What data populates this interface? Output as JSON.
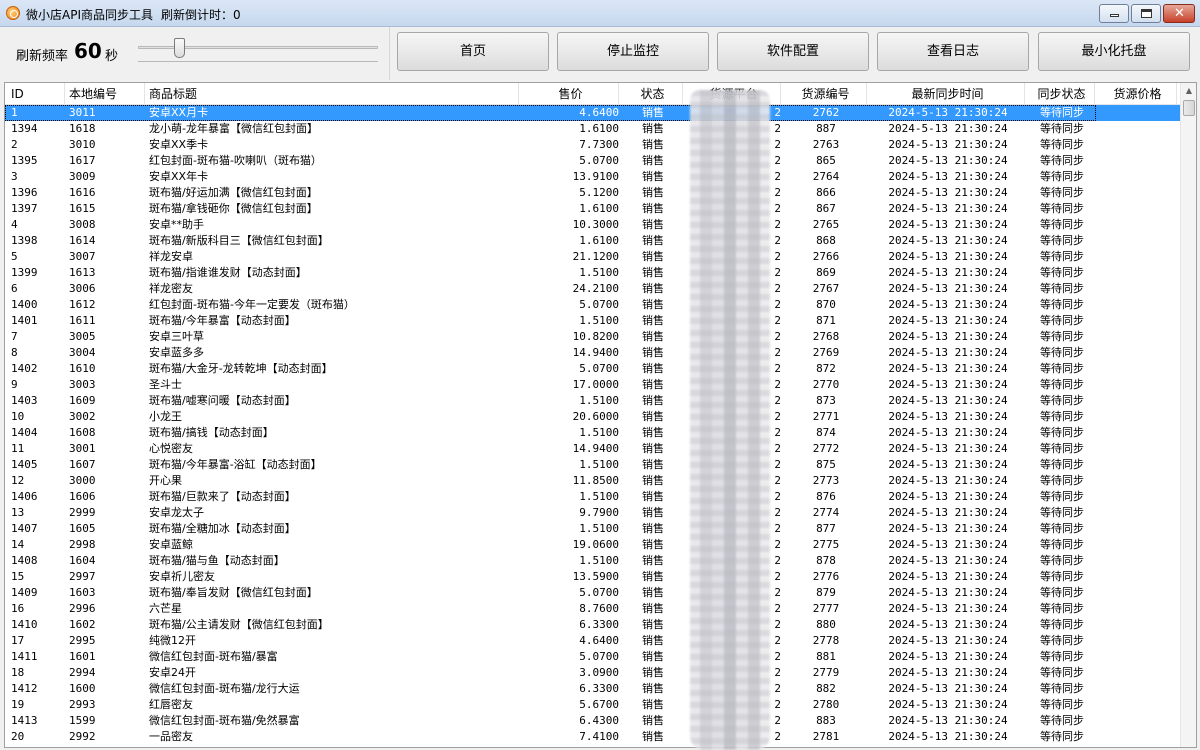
{
  "window": {
    "title": "微小店API商品同步工具",
    "countdown_label": "刷新倒计时：",
    "countdown_value": "0"
  },
  "toolbar": {
    "refresh_label": "刷新频率",
    "refresh_value": "60",
    "refresh_unit": "秒",
    "slider_fraction": 0.17,
    "buttons": [
      "首页",
      "停止监控",
      "软件配置",
      "查看日志",
      "最小化托盘"
    ]
  },
  "table": {
    "columns": [
      "ID",
      "本地编号",
      "商品标题",
      "售价",
      "状态",
      "货源平台",
      "货源编号",
      "最新同步时间",
      "同步状态",
      "货源价格"
    ],
    "selected_row": 0,
    "rows": [
      [
        "1",
        "3011",
        "安卓XX月卡",
        "4.6400",
        "销售",
        "2",
        "2762",
        "2024-5-13 21:30:24",
        "等待同步",
        ""
      ],
      [
        "1394",
        "1618",
        "龙小萌-龙年暴富【微信红包封面】",
        "1.6100",
        "销售",
        "2",
        "887",
        "2024-5-13 21:30:24",
        "等待同步",
        ""
      ],
      [
        "2",
        "3010",
        "安卓XX季卡",
        "7.7300",
        "销售",
        "2",
        "2763",
        "2024-5-13 21:30:24",
        "等待同步",
        ""
      ],
      [
        "1395",
        "1617",
        "红包封面-斑布猫-吹喇叭（斑布猫）",
        "5.0700",
        "销售",
        "2",
        "865",
        "2024-5-13 21:30:24",
        "等待同步",
        ""
      ],
      [
        "3",
        "3009",
        "安卓XX年卡",
        "13.9100",
        "销售",
        "2",
        "2764",
        "2024-5-13 21:30:24",
        "等待同步",
        ""
      ],
      [
        "1396",
        "1616",
        "斑布猫/好运加满【微信红包封面】",
        "5.1200",
        "销售",
        "2",
        "866",
        "2024-5-13 21:30:24",
        "等待同步",
        ""
      ],
      [
        "1397",
        "1615",
        "斑布猫/拿钱砸你【微信红包封面】",
        "1.6100",
        "销售",
        "2",
        "867",
        "2024-5-13 21:30:24",
        "等待同步",
        ""
      ],
      [
        "4",
        "3008",
        "安卓**助手",
        "10.3000",
        "销售",
        "2",
        "2765",
        "2024-5-13 21:30:24",
        "等待同步",
        ""
      ],
      [
        "1398",
        "1614",
        "斑布猫/新版科目三【微信红包封面】",
        "1.6100",
        "销售",
        "2",
        "868",
        "2024-5-13 21:30:24",
        "等待同步",
        ""
      ],
      [
        "5",
        "3007",
        "祥龙安卓",
        "21.1200",
        "销售",
        "2",
        "2766",
        "2024-5-13 21:30:24",
        "等待同步",
        ""
      ],
      [
        "1399",
        "1613",
        "斑布猫/指谁谁发财【动态封面】",
        "1.5100",
        "销售",
        "2",
        "869",
        "2024-5-13 21:30:24",
        "等待同步",
        ""
      ],
      [
        "6",
        "3006",
        "祥龙密友",
        "24.2100",
        "销售",
        "2",
        "2767",
        "2024-5-13 21:30:24",
        "等待同步",
        ""
      ],
      [
        "1400",
        "1612",
        "红包封面-斑布猫-今年一定要发（斑布猫）",
        "5.0700",
        "销售",
        "2",
        "870",
        "2024-5-13 21:30:24",
        "等待同步",
        ""
      ],
      [
        "1401",
        "1611",
        "斑布猫/今年暴富【动态封面】",
        "1.5100",
        "销售",
        "2",
        "871",
        "2024-5-13 21:30:24",
        "等待同步",
        ""
      ],
      [
        "7",
        "3005",
        "安卓三叶草",
        "10.8200",
        "销售",
        "2",
        "2768",
        "2024-5-13 21:30:24",
        "等待同步",
        ""
      ],
      [
        "8",
        "3004",
        "安卓蓝多多",
        "14.9400",
        "销售",
        "2",
        "2769",
        "2024-5-13 21:30:24",
        "等待同步",
        ""
      ],
      [
        "1402",
        "1610",
        "斑布猫/大金牙-龙转乾坤【动态封面】",
        "5.0700",
        "销售",
        "2",
        "872",
        "2024-5-13 21:30:24",
        "等待同步",
        ""
      ],
      [
        "9",
        "3003",
        "圣斗士",
        "17.0000",
        "销售",
        "2",
        "2770",
        "2024-5-13 21:30:24",
        "等待同步",
        ""
      ],
      [
        "1403",
        "1609",
        "斑布猫/嘘寒问暖【动态封面】",
        "1.5100",
        "销售",
        "2",
        "873",
        "2024-5-13 21:30:24",
        "等待同步",
        ""
      ],
      [
        "10",
        "3002",
        "小龙王",
        "20.6000",
        "销售",
        "2",
        "2771",
        "2024-5-13 21:30:24",
        "等待同步",
        ""
      ],
      [
        "1404",
        "1608",
        "斑布猫/搞钱【动态封面】",
        "1.5100",
        "销售",
        "2",
        "874",
        "2024-5-13 21:30:24",
        "等待同步",
        ""
      ],
      [
        "11",
        "3001",
        "心悦密友",
        "14.9400",
        "销售",
        "2",
        "2772",
        "2024-5-13 21:30:24",
        "等待同步",
        ""
      ],
      [
        "1405",
        "1607",
        "斑布猫/今年暴富-浴缸【动态封面】",
        "1.5100",
        "销售",
        "2",
        "875",
        "2024-5-13 21:30:24",
        "等待同步",
        ""
      ],
      [
        "12",
        "3000",
        "开心果",
        "11.8500",
        "销售",
        "2",
        "2773",
        "2024-5-13 21:30:24",
        "等待同步",
        ""
      ],
      [
        "1406",
        "1606",
        "斑布猫/巨款来了【动态封面】",
        "1.5100",
        "销售",
        "2",
        "876",
        "2024-5-13 21:30:24",
        "等待同步",
        ""
      ],
      [
        "13",
        "2999",
        "安卓龙太子",
        "9.7900",
        "销售",
        "2",
        "2774",
        "2024-5-13 21:30:24",
        "等待同步",
        ""
      ],
      [
        "1407",
        "1605",
        "斑布猫/全糖加冰【动态封面】",
        "1.5100",
        "销售",
        "2",
        "877",
        "2024-5-13 21:30:24",
        "等待同步",
        ""
      ],
      [
        "14",
        "2998",
        "安卓蓝鲸",
        "19.0600",
        "销售",
        "2",
        "2775",
        "2024-5-13 21:30:24",
        "等待同步",
        ""
      ],
      [
        "1408",
        "1604",
        "斑布猫/猫与鱼【动态封面】",
        "1.5100",
        "销售",
        "2",
        "878",
        "2024-5-13 21:30:24",
        "等待同步",
        ""
      ],
      [
        "15",
        "2997",
        "安卓祈儿密友",
        "13.5900",
        "销售",
        "2",
        "2776",
        "2024-5-13 21:30:24",
        "等待同步",
        ""
      ],
      [
        "1409",
        "1603",
        "斑布猫/奉旨发财【微信红包封面】",
        "5.0700",
        "销售",
        "2",
        "879",
        "2024-5-13 21:30:24",
        "等待同步",
        ""
      ],
      [
        "16",
        "2996",
        "六芒星",
        "8.7600",
        "销售",
        "2",
        "2777",
        "2024-5-13 21:30:24",
        "等待同步",
        ""
      ],
      [
        "1410",
        "1602",
        "斑布猫/公主请发财【微信红包封面】",
        "6.3300",
        "销售",
        "2",
        "880",
        "2024-5-13 21:30:24",
        "等待同步",
        ""
      ],
      [
        "17",
        "2995",
        "纯微12开",
        "4.6400",
        "销售",
        "2",
        "2778",
        "2024-5-13 21:30:24",
        "等待同步",
        ""
      ],
      [
        "1411",
        "1601",
        "微信红包封面-斑布猫/暴富",
        "5.0700",
        "销售",
        "2",
        "881",
        "2024-5-13 21:30:24",
        "等待同步",
        ""
      ],
      [
        "18",
        "2994",
        "安卓24开",
        "3.0900",
        "销售",
        "2",
        "2779",
        "2024-5-13 21:30:24",
        "等待同步",
        ""
      ],
      [
        "1412",
        "1600",
        "微信红包封面-斑布猫/龙行大运",
        "6.3300",
        "销售",
        "2",
        "882",
        "2024-5-13 21:30:24",
        "等待同步",
        ""
      ],
      [
        "19",
        "2993",
        "红唇密友",
        "5.6700",
        "销售",
        "2",
        "2780",
        "2024-5-13 21:30:24",
        "等待同步",
        ""
      ],
      [
        "1413",
        "1599",
        "微信红包封面-斑布猫/免然暴富",
        "6.4300",
        "销售",
        "2",
        "883",
        "2024-5-13 21:30:24",
        "等待同步",
        ""
      ],
      [
        "20",
        "2992",
        "一品密友",
        "7.4100",
        "销售",
        "2",
        "2781",
        "2024-5-13 21:30:24",
        "等待同步",
        ""
      ]
    ]
  }
}
